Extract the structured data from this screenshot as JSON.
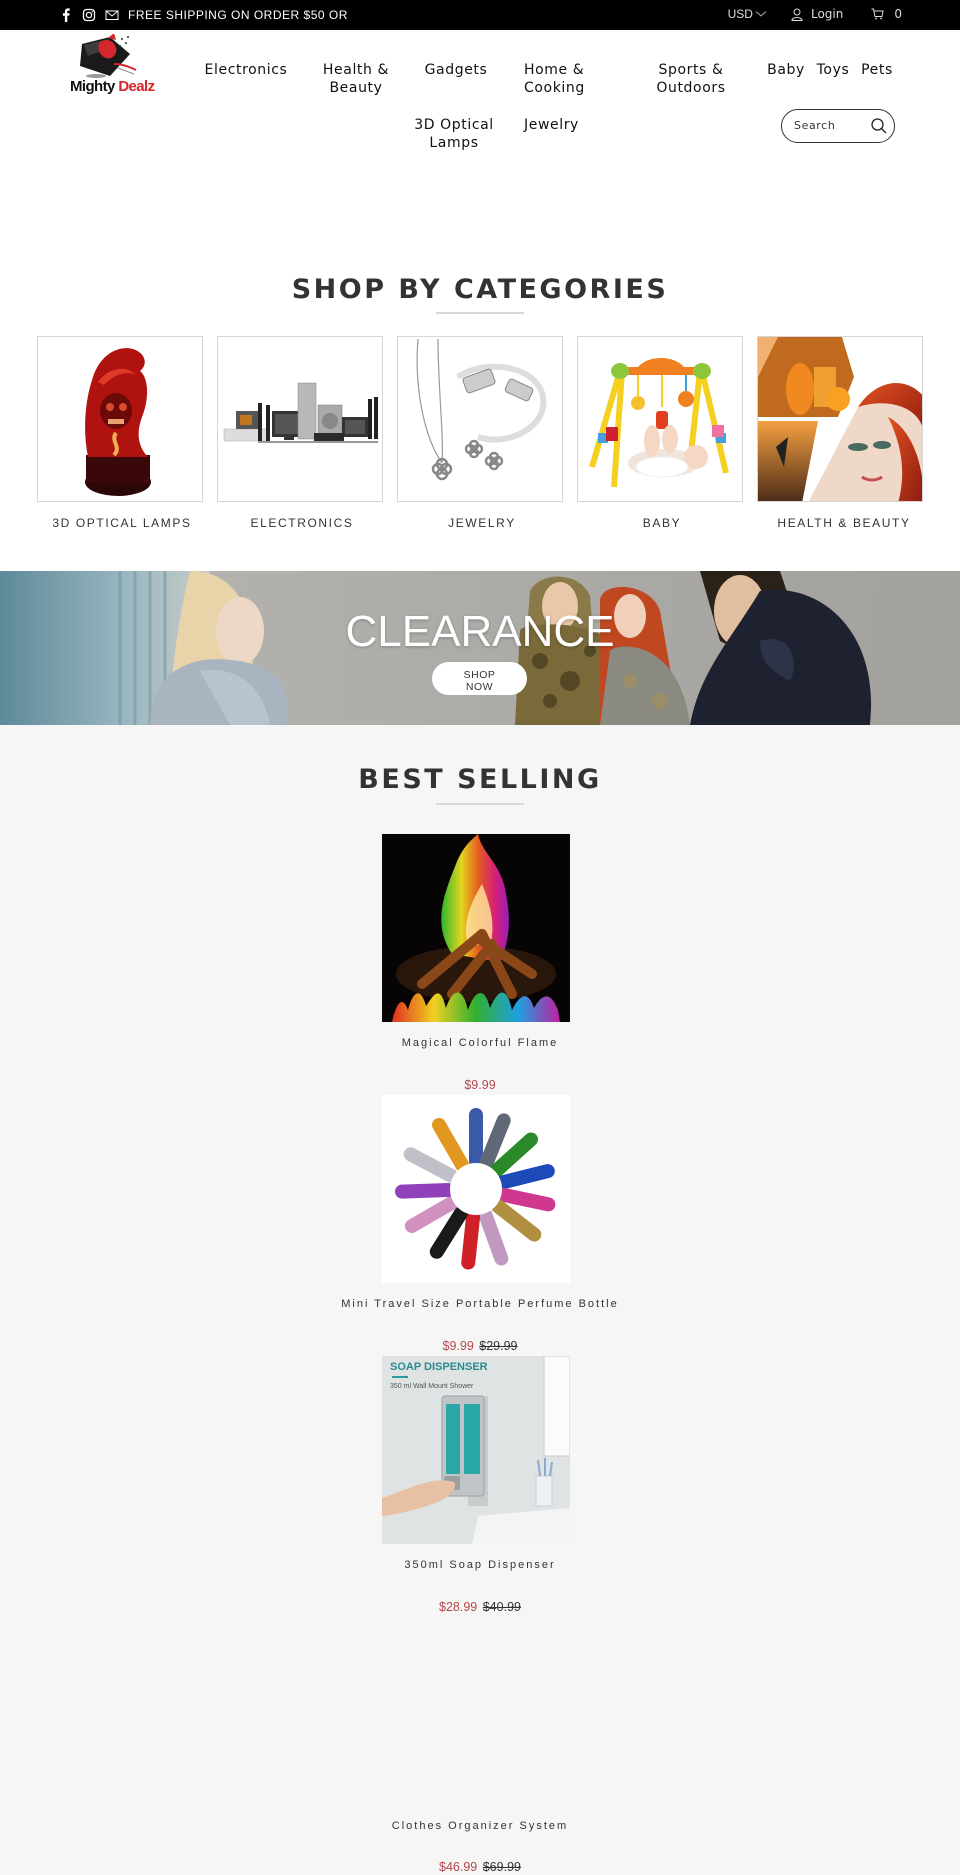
{
  "topbar": {
    "icons": [
      "facebook-icon",
      "instagram-icon",
      "mail-icon"
    ],
    "promo": "FREE SHIPPING ON ORDER $50 OR",
    "currency": "USD",
    "login": "Login",
    "cart_count": "0"
  },
  "header": {
    "logo": {
      "word1": "Mighty",
      "word2": "Dealz"
    },
    "nav": [
      {
        "label": "Electronics"
      },
      {
        "label": "Health & Beauty"
      },
      {
        "label": "Gadgets"
      },
      {
        "label": "Home & Cooking"
      },
      {
        "label": "Sports & Outdoors"
      },
      {
        "label": "Baby"
      },
      {
        "label": "Toys"
      },
      {
        "label": "Pets"
      },
      {
        "label": "3D Optical Lamps"
      },
      {
        "label": "Jewelry"
      }
    ],
    "search_placeholder": "Search"
  },
  "categories": {
    "title": "SHOP BY CATEGORIES",
    "items": [
      {
        "label": "3D OPTICAL LAMPS",
        "image": "red skull 3D lamp"
      },
      {
        "label": "ELECTRONICS",
        "image": "home appliances set"
      },
      {
        "label": "JEWELRY",
        "image": "silver clover necklace and bracelet"
      },
      {
        "label": "BABY",
        "image": "baby play gym"
      },
      {
        "label": "HEALTH & BEAUTY",
        "image": "beauty collage"
      }
    ]
  },
  "banner": {
    "title": "CLEARANCE",
    "button": "SHOP NOW"
  },
  "best_selling": {
    "title": "BEST SELLING",
    "products": [
      {
        "name": "Magical Colorful Flame",
        "price": "$9.99",
        "compare_price": ""
      },
      {
        "name": "Mini Travel Size Portable Perfume Bottle",
        "price": "$9.99",
        "compare_price": "$29.99"
      },
      {
        "name": "350ml  Soap Dispenser",
        "price": "$28.99",
        "compare_price": "$40.99",
        "image_caption": {
          "title": "SOAP DISPENSER",
          "subtitle": "350 ml Wall Mount Shower"
        }
      },
      {
        "name": "Clothes Organizer System",
        "price": "$46.99",
        "compare_price": "$69.99"
      }
    ]
  },
  "colors": {
    "topbar_bg": "#000000",
    "accent_red": "#d4262c",
    "sale_price": "#b6474c",
    "page_bg": "#f6f6f6"
  }
}
